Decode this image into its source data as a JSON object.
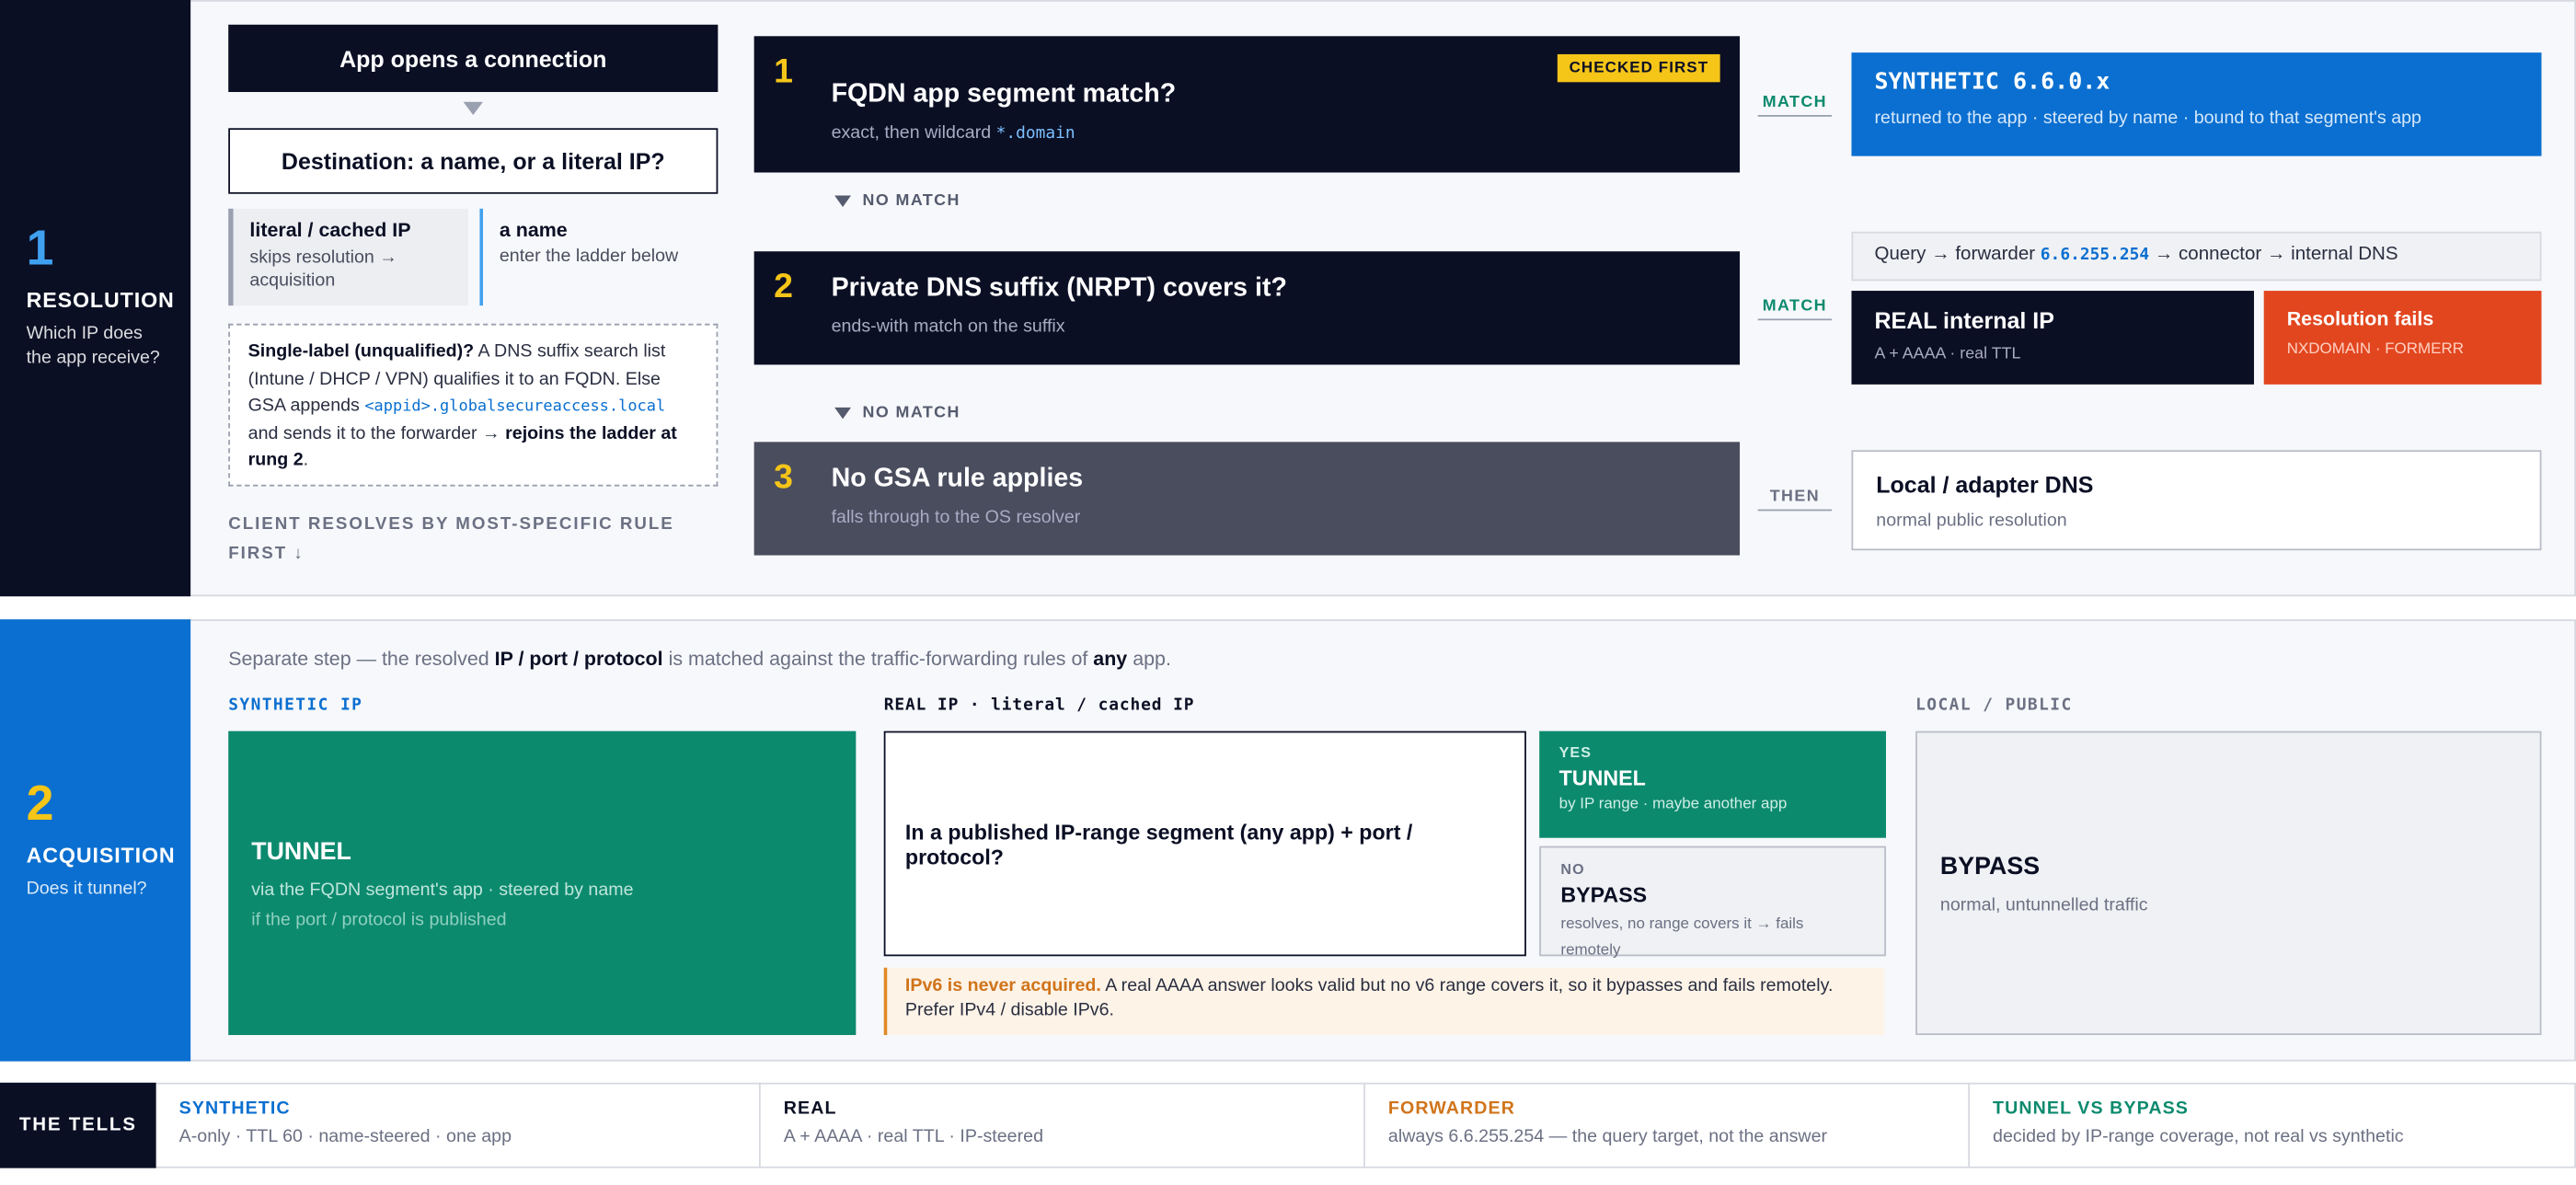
{
  "resolution": {
    "stage_num": "1",
    "stage_title": "RESOLUTION",
    "stage_sub": "Which IP does the app receive?",
    "opens": "App opens a connection",
    "destination": "Destination: a name, or a literal IP?",
    "literal_title": "literal / cached IP",
    "literal_sub": "skips resolution → acquisition",
    "name_title": "a name",
    "name_sub": "enter the ladder below",
    "single_bold": "Single-label (unqualified)?",
    "single_text1": " A DNS suffix search list (Intune / DHCP / VPN) qualifies it to an FQDN. Else GSA appends ",
    "single_code": "<appid>.globalsecureaccess.local",
    "single_text2": " and sends it to the forwarder → ",
    "single_bold2": "rejoins the ladder at rung 2",
    "single_end": ".",
    "client_rule": "CLIENT RESOLVES BY MOST-SPECIFIC RULE FIRST ↓",
    "rung1_num": "1",
    "rung1_title": "FQDN app segment match?",
    "rung1_sub": "exact, then wildcard ",
    "rung1_code": "*.domain",
    "checked_first": "CHECKED FIRST",
    "no_match": "NO MATCH",
    "rung2_num": "2",
    "rung2_title": "Private DNS suffix (NRPT) covers it?",
    "rung2_sub": "ends-with match on the suffix",
    "rung3_num": "3",
    "rung3_title": "No GSA rule applies",
    "rung3_sub": "falls through to the OS resolver",
    "match": "MATCH",
    "then": "THEN",
    "synthetic_title": "SYNTHETIC 6.6.0.x",
    "synthetic_sub": "returned to the app · steered by name · bound to that segment's app",
    "query_text1": "Query → forwarder ",
    "query_code": "6.6.255.254",
    "query_text2": " → connector → internal DNS",
    "real_title": "REAL internal IP",
    "real_sub": "A + AAAA · real TTL",
    "fail_title": "Resolution fails",
    "fail_sub": "NXDOMAIN · FORMERR",
    "local_title": "Local / adapter DNS",
    "local_sub": "normal public resolution"
  },
  "acquisition": {
    "stage_num": "2",
    "stage_title": "ACQUISITION",
    "stage_sub": "Does it tunnel?",
    "intro1": "Separate step — the resolved ",
    "intro_bold": "IP / port / protocol",
    "intro2": " is matched against the traffic-forwarding rules of ",
    "intro_any": "any",
    "intro3": " app.",
    "col1_head": "SYNTHETIC IP",
    "col2_head": "REAL IP · literal / cached IP",
    "col3_head": "LOCAL / PUBLIC",
    "tunnel_title": "TUNNEL",
    "tunnel_sub": "via the FQDN segment's app · steered by name",
    "tunnel_sub2": "if the port / protocol is published",
    "question": "In a published IP-range segment (any app) + port / protocol?",
    "yes_tag": "YES",
    "yes_title": "TUNNEL",
    "yes_sub": "by IP range · maybe another app",
    "no_tag": "NO",
    "no_title": "BYPASS",
    "no_sub": "resolves, no range covers it → fails remotely",
    "ipv6_bold": "IPv6 is never acquired.",
    "ipv6_text": " A real AAAA answer looks valid but no v6 range covers it, so it bypasses and fails remotely. Prefer IPv4 / disable IPv6.",
    "bypass_title": "BYPASS",
    "bypass_sub": "normal, untunnelled traffic"
  },
  "tells": {
    "label": "THE TELLS",
    "items": [
      {
        "head": "SYNTHETIC",
        "text": "A-only · TTL 60 · name-steered · one app"
      },
      {
        "head": "REAL",
        "text": "A + AAAA · real TTL · IP-steered"
      },
      {
        "head": "FORWARDER",
        "text": "always 6.6.255.254 — the query target, not the answer"
      },
      {
        "head": "TUNNEL VS BYPASS",
        "text": "decided by IP-range coverage, not real vs synthetic"
      }
    ]
  },
  "colors": {
    "navy": "#0b0f24",
    "blue": "#0a6fd0",
    "teal": "#0c8a6e",
    "yellow": "#f5c518",
    "orange": "#e2461f",
    "slate": "#4a4d5e"
  }
}
